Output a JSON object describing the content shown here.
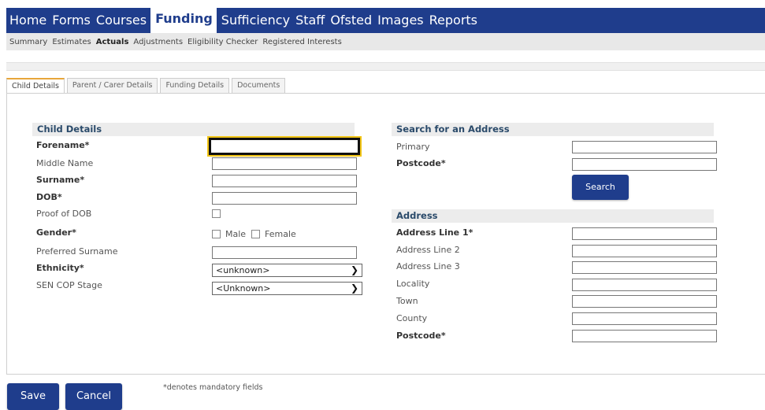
{
  "topnav": {
    "items": [
      "Home",
      "Forms",
      "Courses",
      "Funding",
      "Sufficiency",
      "Staff",
      "Ofsted",
      "Images",
      "Reports"
    ],
    "active": "Funding"
  },
  "subnav": {
    "items": [
      "Summary",
      "Estimates",
      "Actuals",
      "Adjustments",
      "Eligibility Checker",
      "Registered Interests"
    ],
    "active": "Actuals"
  },
  "tabs": [
    "Child Details",
    "Parent / Carer Details",
    "Funding Details",
    "Documents"
  ],
  "child": {
    "heading": "Child Details",
    "forename": "Forename*",
    "middle_name": "Middle Name",
    "surname": "Surname*",
    "dob": "DOB*",
    "proof_dob": "Proof of DOB",
    "gender": "Gender*",
    "male": "Male",
    "female": "Female",
    "preferred_surname": "Preferred Surname",
    "ethnicity": "Ethnicity*",
    "ethnicity_value": "<unknown>",
    "sen": "SEN COP Stage",
    "sen_value": "<Unknown>"
  },
  "search": {
    "heading": "Search for an Address",
    "primary": "Primary",
    "postcode": "Postcode*",
    "button": "Search"
  },
  "address": {
    "heading": "Address",
    "line1": "Address Line 1*",
    "line2": "Address Line 2",
    "line3": "Address Line 3",
    "locality": "Locality",
    "town": "Town",
    "county": "County",
    "postcode": "Postcode*"
  },
  "footer": {
    "save": "Save",
    "cancel": "Cancel",
    "note": "*denotes mandatory fields"
  }
}
